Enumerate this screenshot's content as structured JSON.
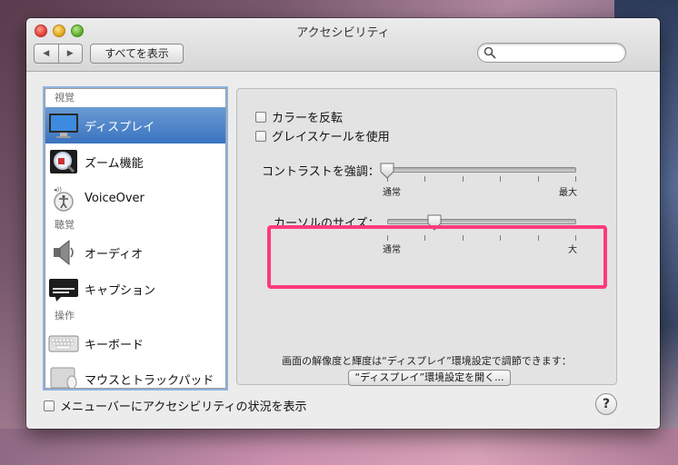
{
  "window": {
    "title": "アクセシビリティ"
  },
  "toolbar": {
    "back_glyph": "◀",
    "forward_glyph": "▶",
    "show_all_label": "すべてを表示",
    "search_placeholder": ""
  },
  "sidebar": {
    "sections": [
      {
        "header": "視覚",
        "items": [
          {
            "label": "ディスプレイ",
            "icon": "display-icon",
            "selected": true
          },
          {
            "label": "ズーム機能",
            "icon": "zoom-icon"
          },
          {
            "label": "VoiceOver",
            "icon": "voiceover-icon"
          }
        ]
      },
      {
        "header": "聴覚",
        "items": [
          {
            "label": "オーディオ",
            "icon": "speaker-icon"
          },
          {
            "label": "キャプション",
            "icon": "caption-icon"
          }
        ]
      },
      {
        "header": "操作",
        "items": [
          {
            "label": "キーボード",
            "icon": "keyboard-icon"
          },
          {
            "label": "マウスとトラックパッド",
            "icon": "mouse-icon"
          }
        ]
      }
    ]
  },
  "content": {
    "invert_colors_label": "カラーを反転",
    "grayscale_label": "グレイスケールを使用",
    "contrast": {
      "label": "コントラストを強調：",
      "min_label": "通常",
      "max_label": "最大",
      "value": 0.0
    },
    "cursor_size": {
      "label": "カーソルのサイズ：",
      "min_label": "通常",
      "max_label": "大",
      "value": 0.25
    },
    "info_text": "画面の解像度と輝度は“ディスプレイ”環境設定で調節できます：",
    "open_display_button": "“ディスプレイ”環境設定を開く..."
  },
  "footer": {
    "menubar_status_label": "メニューバーにアクセシビリティの状況を表示",
    "help_label": "?"
  },
  "colors": {
    "selection": "#3a74c0",
    "highlight": "#ff3a7c"
  }
}
